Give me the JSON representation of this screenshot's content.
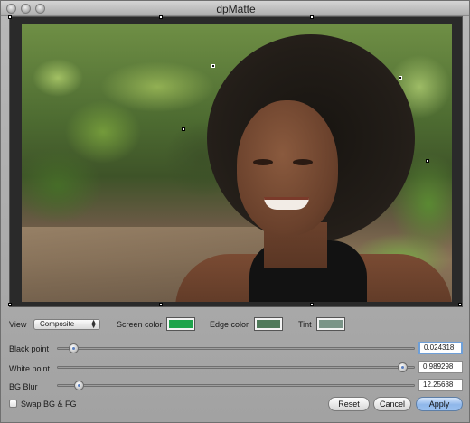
{
  "window": {
    "title": "dpMatte"
  },
  "controls": {
    "view_label": "View",
    "view_value": "Composite",
    "screen_color_label": "Screen color",
    "screen_color": "#1ea44b",
    "edge_color_label": "Edge color",
    "edge_color": "#4f7a5a",
    "tint_label": "Tint",
    "tint_color": "#7a9487"
  },
  "sliders": [
    {
      "label": "Black point",
      "value_text": "0.024318",
      "value": 0.024318
    },
    {
      "label": "White point",
      "value_text": "0.989298",
      "value": 0.989298
    },
    {
      "label": "BG Blur",
      "value_text": "12.25688",
      "value": 0.04
    }
  ],
  "footer": {
    "swap_label": "Swap BG & FG",
    "reset_label": "Reset",
    "cancel_label": "Cancel",
    "apply_label": "Apply"
  },
  "icons": {
    "close": "traffic-light-close",
    "minimize": "traffic-light-minimize",
    "zoom": "traffic-light-zoom",
    "popup_arrows": "up-down-arrows"
  }
}
